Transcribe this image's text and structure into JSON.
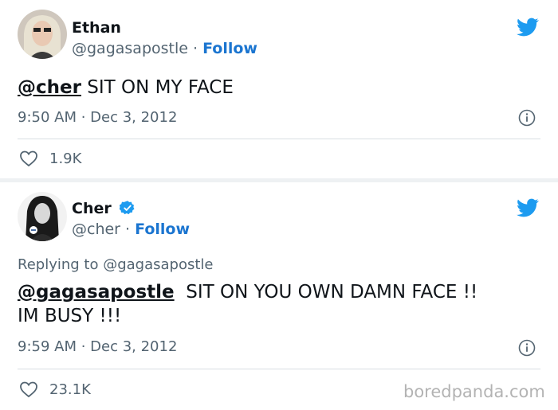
{
  "tweet1": {
    "display_name": "Ethan",
    "handle": "@gagasapostle",
    "separator": " · ",
    "follow_label": "Follow",
    "mention": "@cher",
    "text": " SIT ON MY FACE",
    "timestamp": "9:50 AM · Dec 3, 2012",
    "likes": "1.9K"
  },
  "tweet2": {
    "display_name": "Cher",
    "handle": "@cher",
    "separator": " · ",
    "follow_label": "Follow",
    "replying_to": "Replying to @gagasapostle",
    "mention": "@gagasapostle",
    "text_line1": "  SIT ON YOU OWN DAMN FACE !!",
    "text_line2": "IM BUSY !!!",
    "timestamp": "9:59 AM · Dec 3, 2012",
    "likes": "23.1K"
  },
  "watermark": "boredpanda.com",
  "colors": {
    "twitter_blue": "#1d9bf0",
    "follow_blue": "#1b75d0",
    "secondary_text": "#536471"
  },
  "icons": [
    "twitter-bird-icon",
    "verified-badge-icon",
    "info-icon",
    "heart-icon"
  ]
}
